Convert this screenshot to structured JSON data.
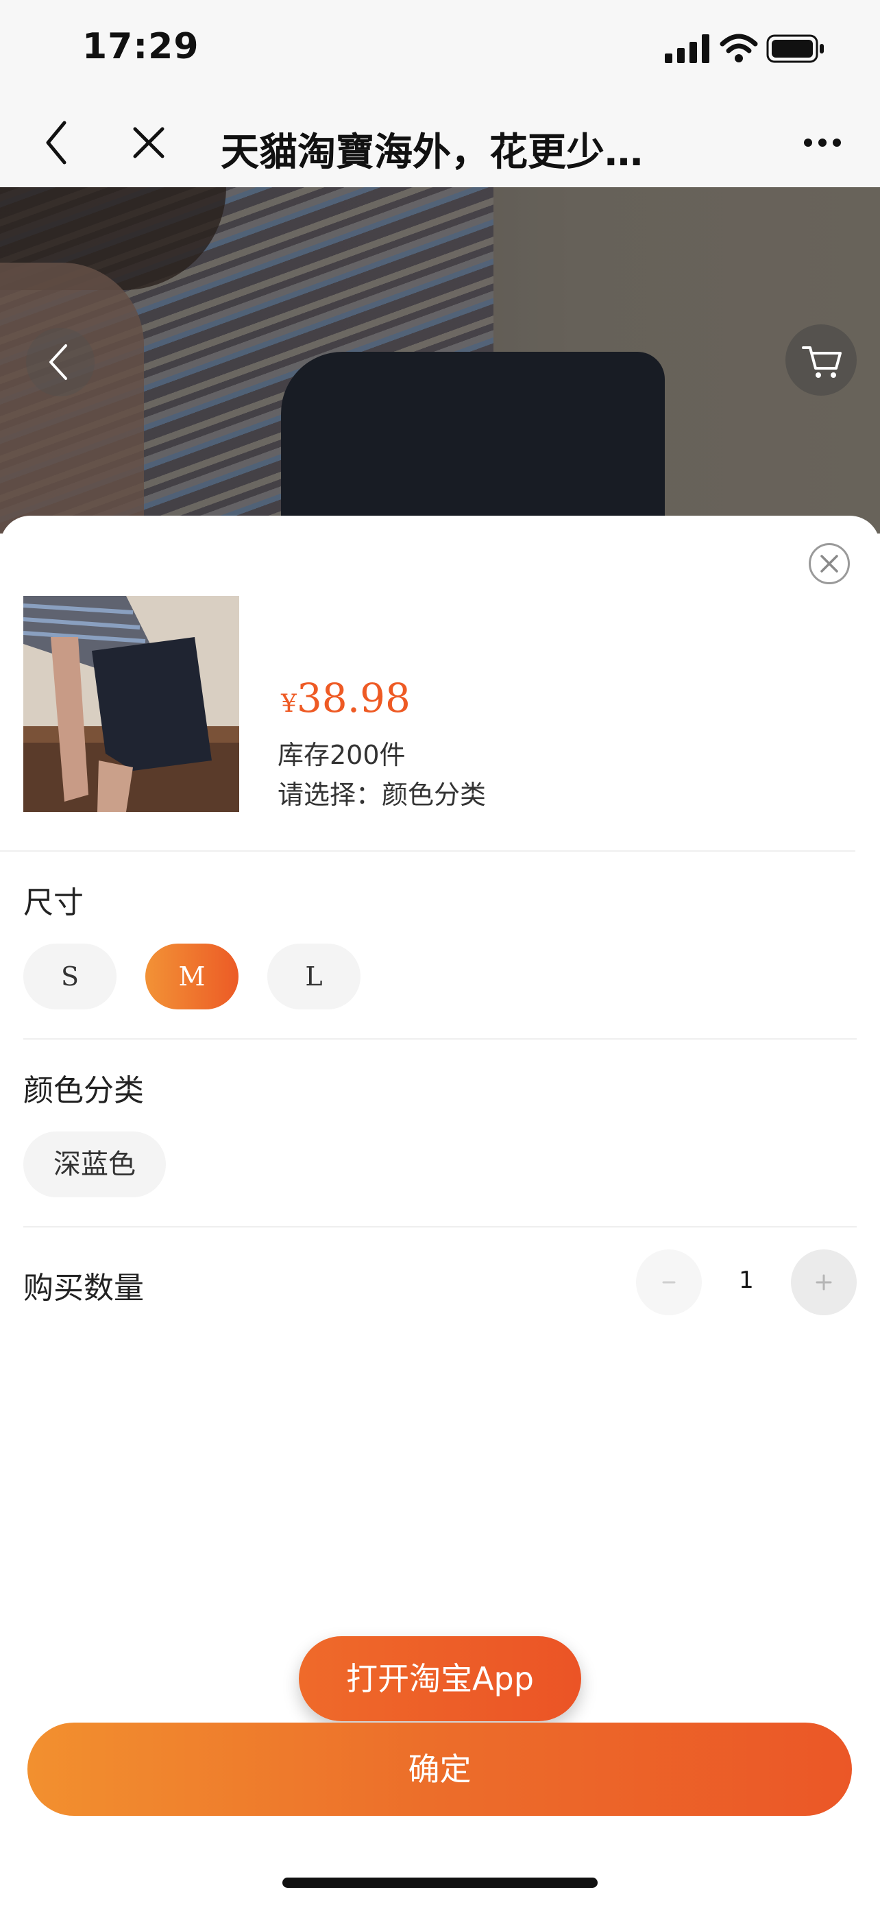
{
  "status_bar": {
    "time": "17:29",
    "signal_icon": "cellular-signal-icon",
    "wifi_icon": "wifi-icon",
    "battery_icon": "battery-icon"
  },
  "nav": {
    "title": "天貓淘寶海外，花更少…",
    "back_icon": "chevron-left-icon",
    "close_icon": "close-icon",
    "more_icon": "more-dots-icon"
  },
  "hero": {
    "back_icon": "chevron-left-icon",
    "cart_icon": "cart-icon"
  },
  "sheet": {
    "close_icon": "close-circle-icon",
    "price_currency": "¥",
    "price_value": "38.98",
    "stock": "库存200件",
    "choose_hint": "请选择：颜色分类",
    "size_label": "尺寸",
    "sizes": [
      {
        "label": "S",
        "selected": false
      },
      {
        "label": "M",
        "selected": true
      },
      {
        "label": "L",
        "selected": false
      }
    ],
    "color_label": "颜色分类",
    "colors": [
      {
        "label": "深蓝色",
        "selected": false
      }
    ],
    "quantity_label": "购买数量",
    "quantity_value": "1",
    "quantity_minus": "−",
    "quantity_plus": "+"
  },
  "buttons": {
    "open_app": "打开淘宝App",
    "confirm": "确定"
  },
  "colors": {
    "accent": "#ee5a24",
    "accent_start": "#f2902f",
    "accent_end": "#eb5727",
    "chip_bg": "#f4f4f4"
  }
}
